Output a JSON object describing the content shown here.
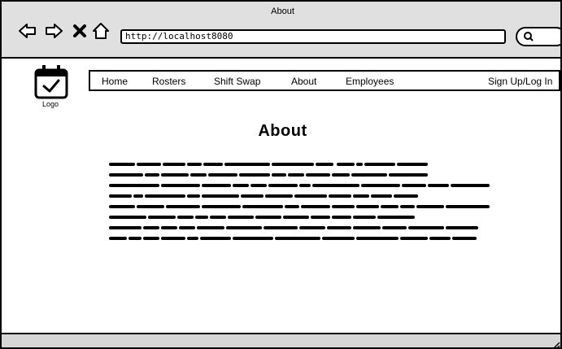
{
  "window": {
    "title": "About"
  },
  "browser": {
    "icons": [
      "back-arrow-icon",
      "forward-arrow-icon",
      "close-icon",
      "home-icon",
      "search-icon"
    ],
    "address": "http://localhost8080"
  },
  "site": {
    "logo_label": "Logo"
  },
  "nav": {
    "home": "Home",
    "rosters": "Rosters",
    "shift_swap": "Shift Swap",
    "about": "About",
    "employees": "Employees",
    "signup": "Sign Up/Log In"
  },
  "page": {
    "heading": "About"
  }
}
